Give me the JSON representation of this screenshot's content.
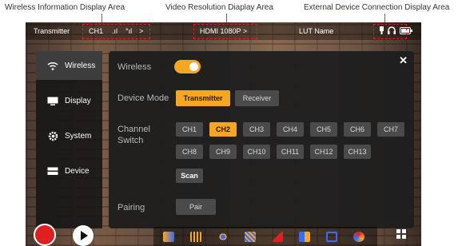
{
  "annotations": {
    "wireless_area": "Wireless Information Display Area",
    "video_area": "Video Resolution Diaplay Area",
    "external_area": "External Device Connection Display Area"
  },
  "topbar": {
    "mode": "Transmitter",
    "channel": "CH1",
    "signal1": ".ıl",
    "signal2": "°ıl",
    "signal_arrow": ">",
    "resolution": "HDMI 1080P >",
    "lut": "LUT Name"
  },
  "sidebar": {
    "items": [
      {
        "label": "Wireless",
        "icon": "wifi-icon",
        "active": true
      },
      {
        "label": "Display",
        "icon": "display-icon",
        "active": false
      },
      {
        "label": "System",
        "icon": "gear-icon",
        "active": false
      },
      {
        "label": "Device",
        "icon": "device-icon",
        "active": false
      }
    ]
  },
  "panel": {
    "close_label": "✕",
    "wireless": {
      "label": "Wireless",
      "enabled": true
    },
    "device_mode": {
      "label": "Device Mode",
      "options": [
        "Transmitter",
        "Receiver"
      ],
      "selected": "Transmitter"
    },
    "channel": {
      "label_line1": "Channel",
      "label_line2": "Switch",
      "row1": [
        "CH1",
        "CH2",
        "CH3",
        "CH4",
        "CH5",
        "CH6",
        "CH7"
      ],
      "row2": [
        "CH8",
        "CH9",
        "CH10",
        "CH11",
        "CH12",
        "CH13"
      ],
      "selected": "CH2",
      "scan_label": "Scan"
    },
    "pairing": {
      "label": "Pairing",
      "button": "Pair"
    }
  },
  "colors": {
    "accent": "#f5a623",
    "record": "#e02020"
  }
}
